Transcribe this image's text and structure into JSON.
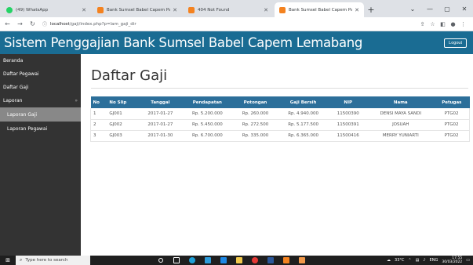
{
  "browser": {
    "tabs": [
      {
        "label": "(49) WhatsApp",
        "favicon_color": "#25d366"
      },
      {
        "label": "Bank Sumsel Babel Capem Palen",
        "favicon_color": "#f4821f"
      },
      {
        "label": "404 Not Found",
        "favicon_color": "#f4821f"
      },
      {
        "label": "Bank Sumsel Babel Capem Palen",
        "favicon_color": "#f4821f"
      }
    ],
    "new_tab": "+",
    "url_host": "localhost",
    "url_path": "/gaji/index.php?p=lam_gaji_dir",
    "window_controls": [
      "⌄",
      "—",
      "▢",
      "✕"
    ]
  },
  "app": {
    "title": "Sistem Penggajian Bank Sumsel Babel Capem Lemabang",
    "logout_label": "Logout",
    "header_color": "#1a6c93"
  },
  "sidebar": {
    "items": [
      {
        "label": "Beranda"
      },
      {
        "label": "Daftar Pegawai"
      },
      {
        "label": "Daftar Gaji"
      },
      {
        "label": "Laporan",
        "caret": "»"
      }
    ],
    "subitems": [
      {
        "label": "Laporan Gaji",
        "active": true
      },
      {
        "label": "Laporan Pegawai",
        "active": false
      }
    ]
  },
  "main": {
    "page_title": "Daftar Gaji",
    "table": {
      "headers": [
        "No",
        "No Slip",
        "Tanggal",
        "Pendapatan",
        "Potongan",
        "Gaji Bersih",
        "NIP",
        "Nama",
        "Petugas"
      ],
      "rows": [
        [
          "1",
          "GJ001",
          "2017-01-27",
          "Rp. 5.200.000",
          "Rp. 260.000",
          "Rp. 4.940.000",
          "11500390",
          "DENSI MAYA SANDI",
          "PTG02"
        ],
        [
          "2",
          "GJ002",
          "2017-01-27",
          "Rp. 5.450.000",
          "Rp. 272.500",
          "Rp. 5.177.500",
          "11500391",
          "JOSUAH",
          "PTG02"
        ],
        [
          "3",
          "GJ003",
          "2017-01-30",
          "Rp. 6.700.000",
          "Rp. 335.000",
          "Rp. 6.365.000",
          "11500416",
          "MERRY YUNIARTI",
          "PTG02"
        ]
      ]
    }
  },
  "taskbar": {
    "search_placeholder": "Type here to search",
    "weather": "33°C",
    "language": "ENG",
    "time": "17:55",
    "date": "30/03/2022"
  }
}
